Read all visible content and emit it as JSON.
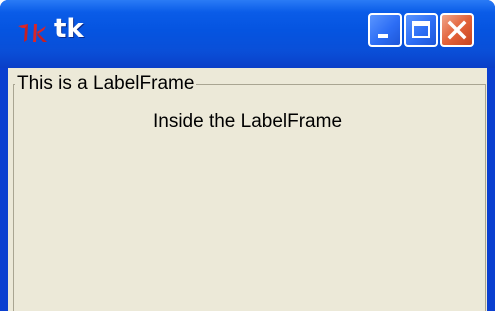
{
  "window": {
    "title": "tk",
    "icon": "tk-feather-icon",
    "controls": [
      "minimize-icon",
      "maximize-icon",
      "close-icon"
    ]
  },
  "labelframe": {
    "legend": "This is a LabelFrame",
    "inner_label": "Inside the LabelFrame"
  },
  "colors": {
    "titlebar": "#0554e0",
    "close_button": "#e3633a",
    "client_background": "#ece9d8",
    "frame_border": "#a9a592"
  }
}
